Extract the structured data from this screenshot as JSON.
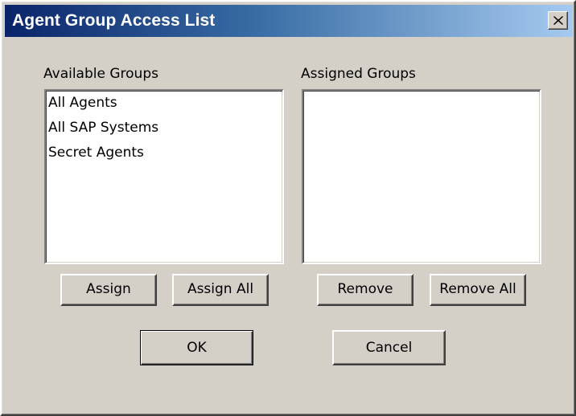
{
  "window": {
    "title": "Agent Group Access List",
    "close_glyph": "close-icon"
  },
  "available": {
    "label": "Available Groups",
    "items": [
      "All Agents",
      "All SAP Systems",
      "Secret Agents"
    ]
  },
  "assigned": {
    "label": "Assigned Groups",
    "items": []
  },
  "buttons": {
    "assign": "Assign",
    "assign_all": "Assign All",
    "remove": "Remove",
    "remove_all": "Remove All",
    "ok": "OK",
    "cancel": "Cancel"
  },
  "colors": {
    "title_start": "#0a246a",
    "title_end": "#a6caf0",
    "face": "#d4d0c8"
  }
}
